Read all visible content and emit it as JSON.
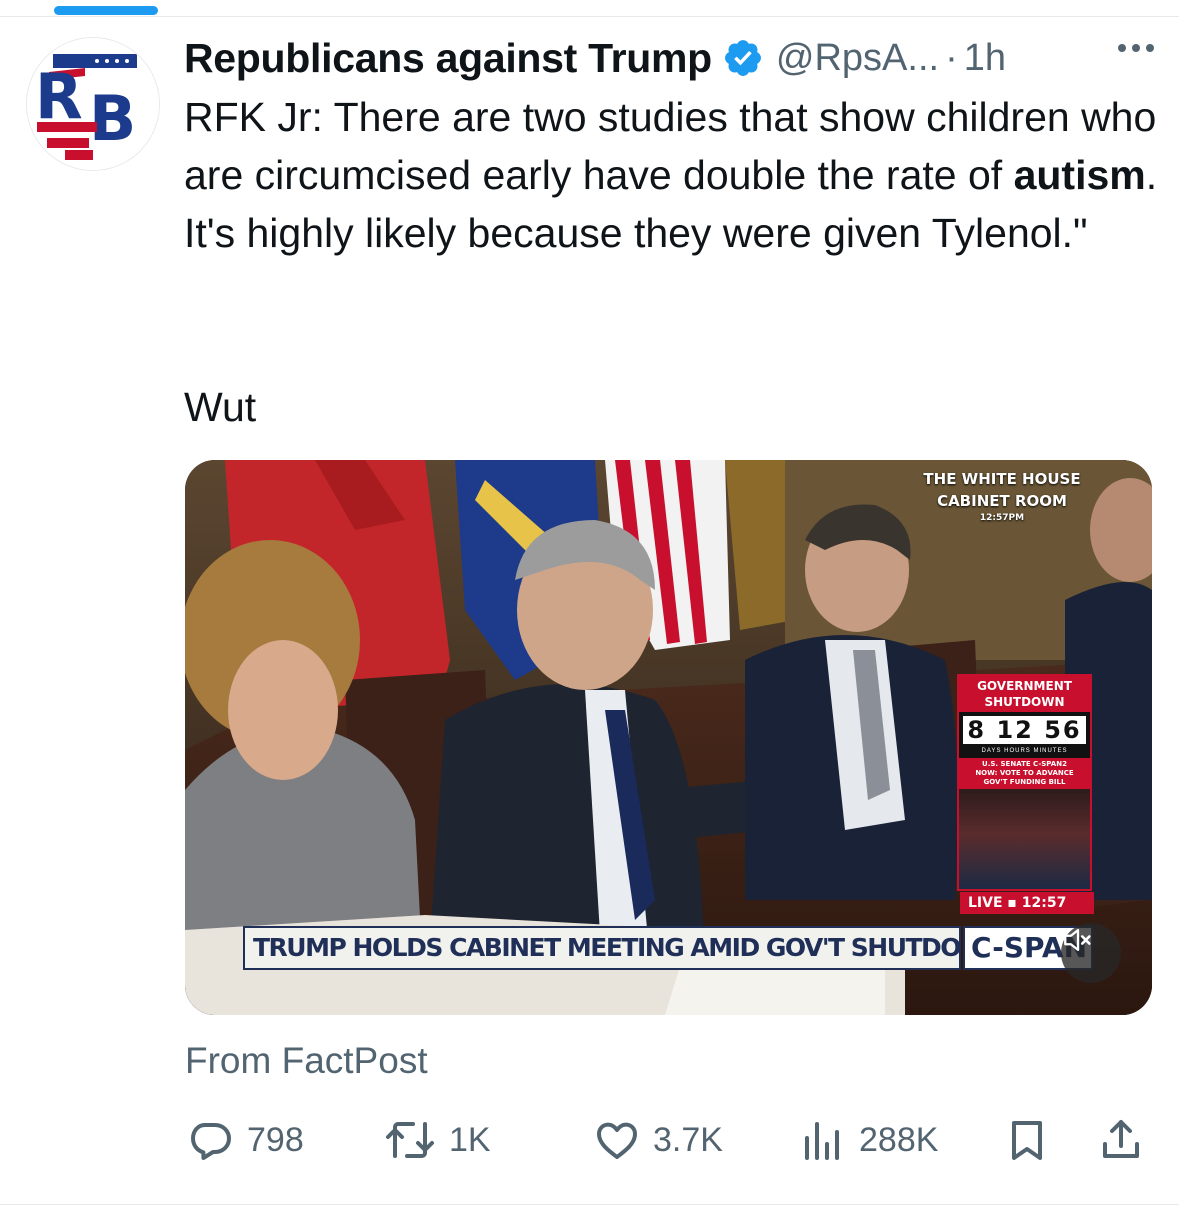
{
  "account": {
    "name": "Republicans against Trump",
    "handle": "@RpsA...",
    "separator": "·",
    "time": "1h",
    "avatar_letters": "RB",
    "verified": true
  },
  "tweet": {
    "text_before_bold": "RFK Jr: There are two studies that show children who are circumcised early have double the rate of ",
    "text_bold": "autism",
    "text_after_bold": ". It's highly likely because they were given Tylenol.\"",
    "second_line": "Wut"
  },
  "media": {
    "bug_line1": "THE WHITE HOUSE",
    "bug_line2": "CABINET ROOM",
    "bug_time": "12:57",
    "bug_time_suffix": "PM",
    "shutdown_title_1": "GOVERNMENT",
    "shutdown_title_2": "SHUTDOWN",
    "shutdown_counter": "8 12 56",
    "shutdown_units": "DAYS HOURS MINUTES",
    "senate_label_1": "U.S. SENATE C-SPAN2",
    "senate_label_2": "NOW: VOTE TO ADVANCE",
    "senate_label_3": "GOV'T FUNDING BILL",
    "live_label": "LIVE",
    "live_time": "12:57",
    "chyron": "TRUMP HOLDS CABINET MEETING AMID GOV'T SHUTDOWN",
    "network_logo": "C-SPAN"
  },
  "source": "From FactPost",
  "actions": {
    "replies": "798",
    "reposts": "1K",
    "likes": "3.7K",
    "views": "288K"
  },
  "colors": {
    "accent": "#1d9bf0",
    "text_primary": "#0f1419",
    "text_secondary": "#536471",
    "cspan_red": "#c8102e",
    "cspan_navy": "#1f2f58"
  },
  "icons": [
    "verified-badge-icon",
    "more-icon",
    "reply-icon",
    "repost-icon",
    "like-icon",
    "views-icon",
    "bookmark-icon",
    "share-icon",
    "mute-icon"
  ]
}
